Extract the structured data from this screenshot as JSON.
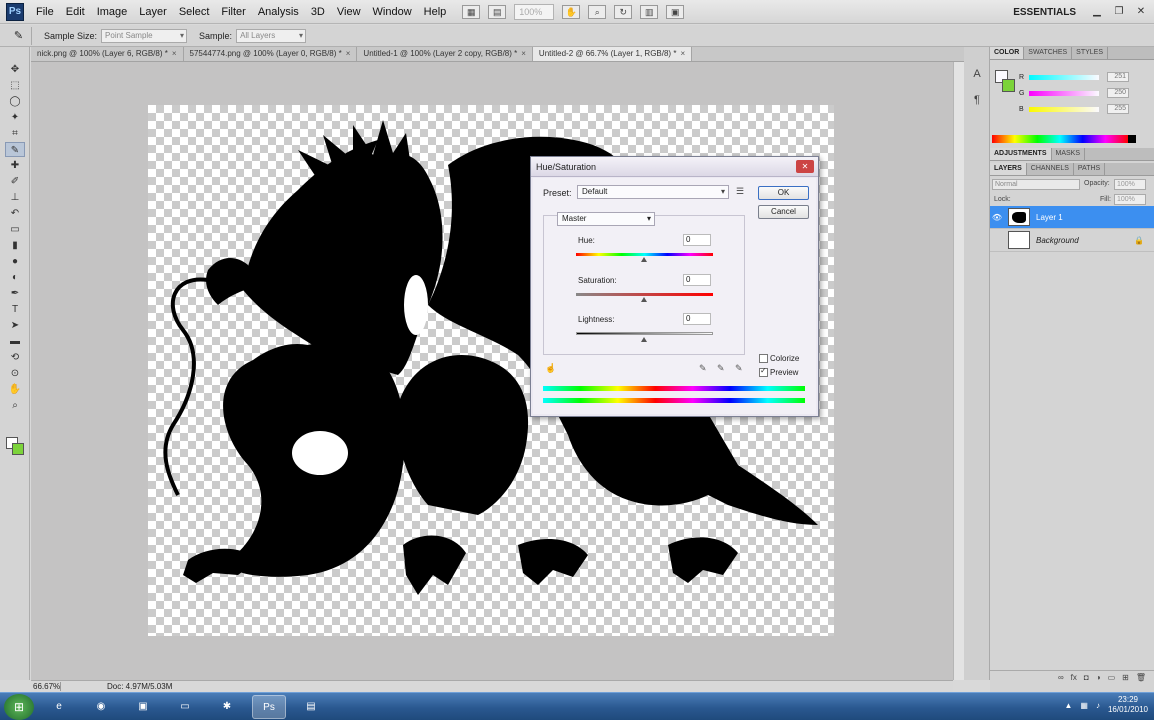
{
  "menu": {
    "items": [
      "File",
      "Edit",
      "Image",
      "Layer",
      "Select",
      "Filter",
      "Analysis",
      "3D",
      "View",
      "Window",
      "Help"
    ],
    "zoom_placeholder": "100%",
    "workspace": "ESSENTIALS"
  },
  "options": {
    "sample_size_label": "Sample Size:",
    "sample_size_value": "Point Sample",
    "sample_label": "Sample:",
    "sample_value": "All Layers"
  },
  "doc_tabs": [
    {
      "label": "nick.png @ 100% (Layer 6, RGB/8) *"
    },
    {
      "label": "57544774.png @ 100% (Layer 0, RGB/8) *"
    },
    {
      "label": "Untitled-1 @ 100% (Layer 2 copy, RGB/8) *"
    },
    {
      "label": "Untitled-2 @ 66.7% (Layer 1, RGB/8) *"
    }
  ],
  "status": {
    "zoom": "66.67%",
    "doc": "Doc: 4.97M/5.03M"
  },
  "color_panel": {
    "tabs": [
      "COLOR",
      "SWATCHES",
      "STYLES"
    ],
    "r_label": "R",
    "r_value": "251",
    "g_label": "G",
    "g_value": "250",
    "b_label": "B",
    "b_value": "255",
    "fg_color": "#fbfaff",
    "bg_color": "#7cd33a"
  },
  "adjustments_tabs": [
    "ADJUSTMENTS",
    "MASKS"
  ],
  "layers_panel": {
    "tabs": [
      "LAYERS",
      "CHANNELS",
      "PATHS"
    ],
    "blend_mode": "Normal",
    "opacity_label": "Opacity:",
    "opacity_value": "100%",
    "lock_label": "Lock:",
    "fill_label": "Fill:",
    "fill_value": "100%",
    "layers": [
      {
        "name": "Layer 1"
      },
      {
        "name": "Background"
      }
    ]
  },
  "dialog": {
    "title": "Hue/Saturation",
    "preset_label": "Preset:",
    "preset_value": "Default",
    "ok_label": "OK",
    "cancel_label": "Cancel",
    "channel": "Master",
    "hue_label": "Hue:",
    "hue_value": "0",
    "saturation_label": "Saturation:",
    "saturation_value": "0",
    "lightness_label": "Lightness:",
    "lightness_value": "0",
    "colorize_label": "Colorize",
    "preview_label": "Preview",
    "colorize_checked": false,
    "preview_checked": true
  },
  "taskbar": {
    "time": "23:29",
    "date": "16/01/2010",
    "ps_label": "Ps"
  }
}
